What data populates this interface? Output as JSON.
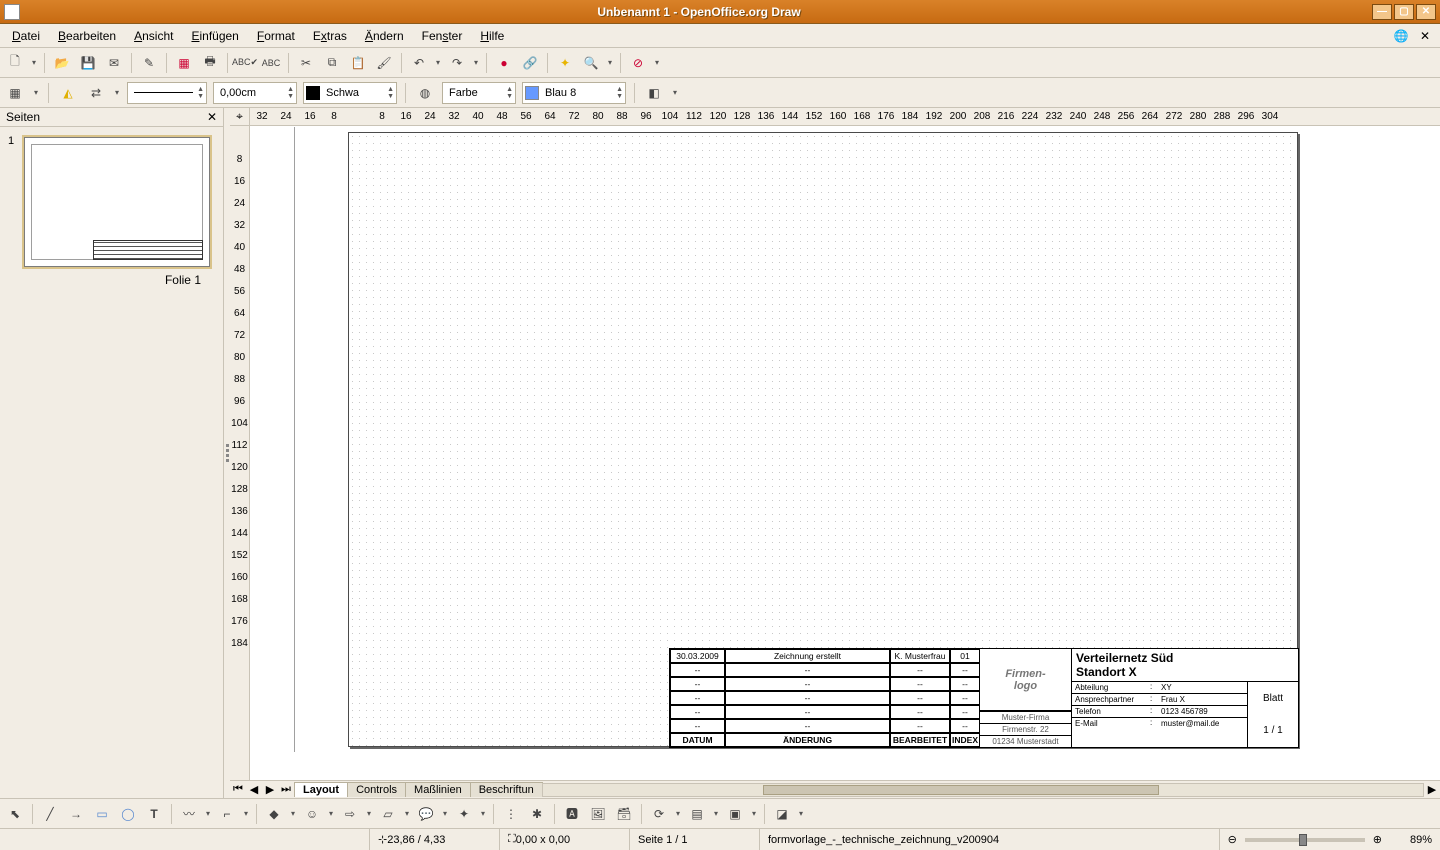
{
  "window": {
    "title": "Unbenannt 1 - OpenOffice.org Draw"
  },
  "menu": {
    "items": [
      "Datei",
      "Bearbeiten",
      "Ansicht",
      "Einfügen",
      "Format",
      "Extras",
      "Ändern",
      "Fenster",
      "Hilfe"
    ]
  },
  "formatbar": {
    "width_value": "0,00cm",
    "line_color": "Schwa",
    "fill_type": "Farbe",
    "fill_color": "Blau 8"
  },
  "panel": {
    "title": "Seiten",
    "page_number": "1",
    "caption": "Folie 1"
  },
  "hruler": [
    "32",
    "24",
    "16",
    "8",
    "",
    "8",
    "16",
    "24",
    "32",
    "40",
    "48",
    "56",
    "64",
    "72",
    "80",
    "88",
    "96",
    "104",
    "112",
    "120",
    "128",
    "136",
    "144",
    "152",
    "160",
    "168",
    "176",
    "184",
    "192",
    "200",
    "208",
    "216",
    "224",
    "232",
    "240",
    "248",
    "256",
    "264",
    "272",
    "280",
    "288",
    "296",
    "304"
  ],
  "vruler": [
    "",
    "8",
    "16",
    "24",
    "32",
    "40",
    "48",
    "56",
    "64",
    "72",
    "80",
    "88",
    "96",
    "104",
    "112",
    "120",
    "128",
    "136",
    "144",
    "152",
    "160",
    "168",
    "176",
    "184"
  ],
  "tabs": {
    "items": [
      "Layout",
      "Controls",
      "Maßlinien",
      "Beschriftun"
    ],
    "active": 0
  },
  "titleblock": {
    "rev_rows": [
      {
        "date": "30.03.2009",
        "change": "Zeichnung erstellt",
        "by": "K. Musterfrau",
        "idx": "01"
      },
      {
        "date": "--",
        "change": "--",
        "by": "--",
        "idx": "--"
      },
      {
        "date": "--",
        "change": "--",
        "by": "--",
        "idx": "--"
      },
      {
        "date": "--",
        "change": "--",
        "by": "--",
        "idx": "--"
      },
      {
        "date": "--",
        "change": "--",
        "by": "--",
        "idx": "--"
      },
      {
        "date": "--",
        "change": "--",
        "by": "--",
        "idx": "--"
      }
    ],
    "rev_headers": {
      "date": "DATUM",
      "change": "ÄNDERUNG",
      "by": "BEARBEITET",
      "idx": "INDEX"
    },
    "logo": "Firmen-\nlogo",
    "drawing_title1": "Verteilernetz Süd",
    "drawing_title2": "Standort X",
    "company": [
      "Muster-Firma",
      "Firmenstr. 22",
      "01234 Musterstadt"
    ],
    "details": [
      {
        "k": "Abteilung",
        "v": "XY"
      },
      {
        "k": "Ansprechpartner",
        "v": "Frau X"
      },
      {
        "k": "Telefon",
        "v": "0123 456789"
      },
      {
        "k": "E-Mail",
        "v": "muster@mail.de"
      }
    ],
    "sheet_label": "Blatt",
    "sheet_value": "1 / 1"
  },
  "statusbar": {
    "pos": "23,86 / 4,33",
    "size": "0,00 x 0,00",
    "page": "Seite 1 / 1",
    "template": "formvorlage_-_technische_zeichnung_v200904",
    "zoom": "89%"
  }
}
